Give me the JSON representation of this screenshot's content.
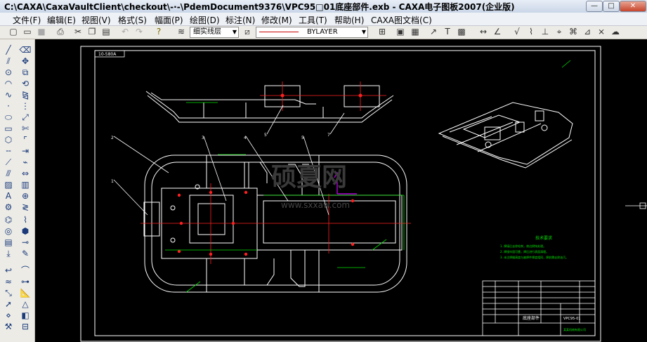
{
  "window": {
    "title": "C:\\CAXA\\CaxaVaultClient\\checkout\\-·-\\PdemDocument9376\\VPC95□01底座部件.exb - CAXA电子图板2007(企业版)",
    "buttons": {
      "minimize": "—",
      "maximize": "□",
      "close": "✕"
    }
  },
  "menu": [
    "文件(F)",
    "编辑(E)",
    "视图(V)",
    "格式(S)",
    "幅面(P)",
    "绘图(D)",
    "标注(N)",
    "修改(M)",
    "工具(T)",
    "帮助(H)",
    "CAXA图文档(C)"
  ],
  "toolbar": {
    "layer": "细实线层",
    "linetype": "BYLAYER"
  },
  "drawing": {
    "header_tag": "10-580A",
    "balloons": [
      "2",
      "3",
      "4",
      "5",
      "7",
      "2",
      "3",
      "4",
      "5",
      "1"
    ],
    "notes_title": "技术要求",
    "notes": [
      "1. 焊接后去除毛刺，棱边倒钝处理。",
      "2. 焊接牢固可靠，焊后进行表面清理。",
      "3. 未注焊缝高度与被焊件厚度相同，焊前需去除油污。"
    ],
    "title_block": {
      "part_name": "底座部件",
      "drawing_no": "VPC95-01",
      "company": "某某机械有限公司"
    },
    "watermark_main": "硕夏网",
    "watermark_url": "www.sxxaw.com",
    "colors": {
      "background": "#000000",
      "lines": "#ffffff",
      "dims": "#00ff00",
      "center": "#ff2020",
      "accent": "#d000ff"
    }
  }
}
